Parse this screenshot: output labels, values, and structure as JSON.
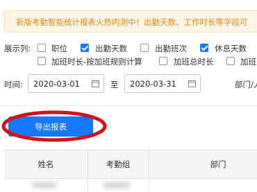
{
  "banner": {
    "text": "新版考勤智能统计报表火热内测中！出勤天数、工作时长等字段可"
  },
  "columns_filter": {
    "label": "展示列:",
    "options": [
      {
        "label": "职位",
        "checked": false
      },
      {
        "label": "出勤天数",
        "checked": true
      },
      {
        "label": "出勤班次",
        "checked": false
      },
      {
        "label": "休息天数",
        "checked": true
      },
      {
        "label": "加班时长-按加班规则计算",
        "checked": false
      },
      {
        "label": "加班总时长",
        "checked": false
      },
      {
        "label": "加班",
        "checked": false
      }
    ]
  },
  "time_filter": {
    "label": "时间:",
    "start": "2020-03-01",
    "separator": "至",
    "end": "2020-03-31",
    "dept_label": "部门/人"
  },
  "actions": {
    "export_label": "导出报表"
  },
  "table": {
    "headers": [
      "姓名",
      "考勤组",
      "部门"
    ]
  },
  "colors": {
    "accent": "#1677ff",
    "banner_text": "#e08a1c",
    "banner_bg": "#fdf6e6",
    "annotation": "#d0121b"
  }
}
